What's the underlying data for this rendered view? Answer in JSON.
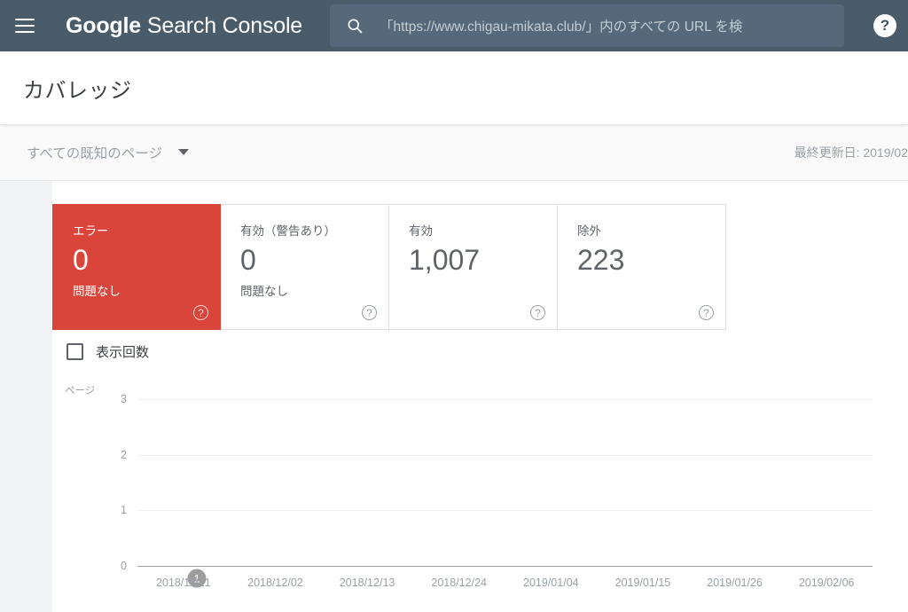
{
  "appbar": {
    "menu_icon": "hamburger-menu-icon",
    "brand_primary": "Google",
    "brand_secondary": "Search Console",
    "search": {
      "icon": "search-icon",
      "placeholder": "「https://www.chigau-mikata.club/」内のすべての URL を検",
      "value": ""
    },
    "help_icon_label": "?"
  },
  "header": {
    "title": "カバレッジ"
  },
  "filterbar": {
    "filter_label": "すべての既知のページ",
    "dropdown_icon": "chevron-down-icon",
    "last_updated": "最終更新日: 2019/02"
  },
  "cards": [
    {
      "label": "エラー",
      "value": "0",
      "sub": "問題なし",
      "variant": "error",
      "help": "?"
    },
    {
      "label": "有効（警告あり）",
      "value": "0",
      "sub": "問題なし",
      "variant": "default",
      "help": "?"
    },
    {
      "label": "有効",
      "value": "1,007",
      "sub": "",
      "variant": "default",
      "help": "?"
    },
    {
      "label": "除外",
      "value": "223",
      "sub": "",
      "variant": "default",
      "help": "?"
    }
  ],
  "chart_controls": {
    "impressions_checkbox_label": "表示回数",
    "impressions_checked": false
  },
  "chart_data": {
    "type": "line",
    "title": "",
    "xlabel": "",
    "ylabel": "ページ",
    "ylim": [
      0,
      3
    ],
    "yticks": [
      "3",
      "2",
      "1",
      "0"
    ],
    "grid": true,
    "legend": "none",
    "categories": [
      "2018/11/21",
      "2018/12/02",
      "2018/12/13",
      "2018/12/24",
      "2019/01/04",
      "2019/01/15",
      "2019/01/26",
      "2019/02/06"
    ],
    "series": [
      {
        "name": "エラー",
        "values": [
          0,
          0,
          0,
          0,
          0,
          0,
          0,
          0
        ]
      }
    ],
    "annotations": [
      {
        "label": "1",
        "x_fraction": 0.081,
        "note": "annotation marker on axis"
      }
    ]
  },
  "colors": {
    "appbar_bg": "#4a5c6a",
    "search_bg": "#56697a",
    "error_red": "#d9453a",
    "page_bg": "#f1f3f4",
    "text_primary": "#3c4043",
    "text_secondary": "#5f6368",
    "text_muted": "#9aa0a6"
  }
}
